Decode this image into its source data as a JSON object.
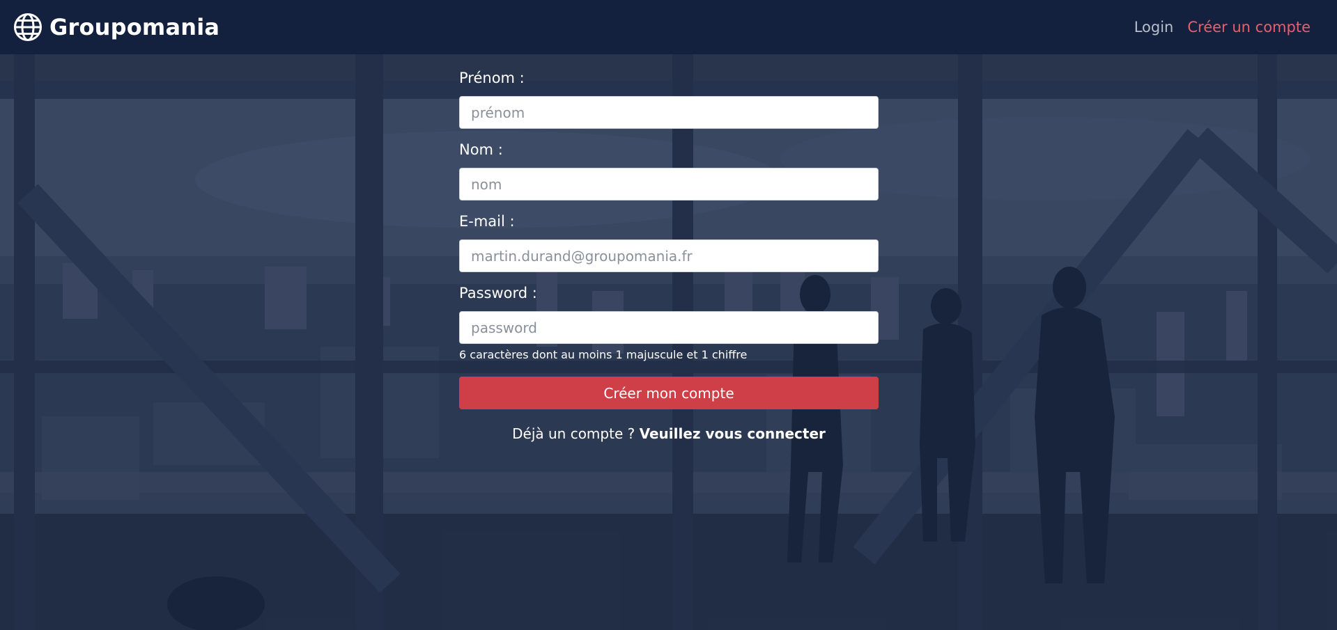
{
  "header": {
    "brand": "Groupomania",
    "logo_icon": "globe-icon",
    "nav": {
      "login": "Login",
      "signup": "Créer un compte"
    }
  },
  "form": {
    "first_name": {
      "label": "Prénom :",
      "placeholder": "prénom",
      "value": ""
    },
    "last_name": {
      "label": "Nom :",
      "placeholder": "nom",
      "value": ""
    },
    "email": {
      "label": "E-mail :",
      "placeholder": "martin.durand@groupomania.fr",
      "value": ""
    },
    "password": {
      "label": "Password :",
      "placeholder": "password",
      "value": "",
      "hint": "6 caractères dont au moins 1 majuscule et 1 chiffre"
    },
    "submit_label": "Créer mon compte",
    "already_prefix": "Déjà un compte ?",
    "already_link": "Veuillez vous connecter"
  },
  "colors": {
    "header_bg": "#14213e",
    "accent": "#cf3f48",
    "signup_link": "#e8606d"
  }
}
